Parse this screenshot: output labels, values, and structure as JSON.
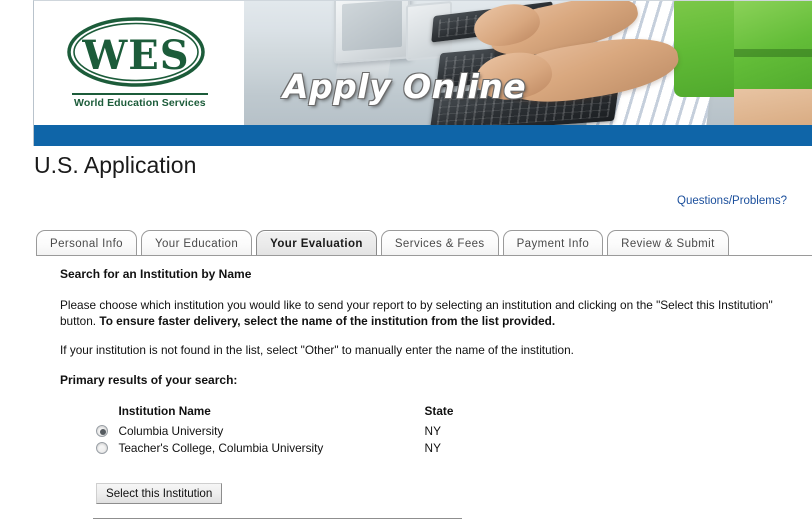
{
  "banner": {
    "logo_text": "WES",
    "logo_subtitle": "World Education Services",
    "title": "Apply Online"
  },
  "header": {
    "page_title": "U.S. Application",
    "help_link": "Questions/Problems?"
  },
  "tabs": [
    {
      "label": "Personal Info",
      "active": false
    },
    {
      "label": "Your Education",
      "active": false
    },
    {
      "label": "Your Evaluation",
      "active": true
    },
    {
      "label": "Services & Fees",
      "active": false
    },
    {
      "label": "Payment Info",
      "active": false
    },
    {
      "label": "Review & Submit",
      "active": false
    }
  ],
  "main": {
    "section_heading": "Search for an Institution by Name",
    "paragraph1_part1": "Please choose which institution you would like to send your report to by selecting an institution and clicking on the \"Select this Institution\" button. ",
    "paragraph1_bold": "To ensure faster delivery, select the name of the institution from the list provided.",
    "paragraph2": "If your institution is not found in the list, select \"Other\" to manually enter the name of the institution.",
    "results_label": "Primary results of your search:",
    "table": {
      "columns": [
        "Institution Name",
        "State"
      ],
      "rows": [
        {
          "name": "Columbia University",
          "state": "NY",
          "selected": true
        },
        {
          "name": "Teacher's College, Columbia University",
          "state": "NY",
          "selected": false
        }
      ]
    },
    "select_button": "Select this Institution"
  },
  "colors": {
    "brand_blue": "#0f65a8",
    "brand_green": "#1c5c3a",
    "link_blue": "#1b4f9c"
  }
}
